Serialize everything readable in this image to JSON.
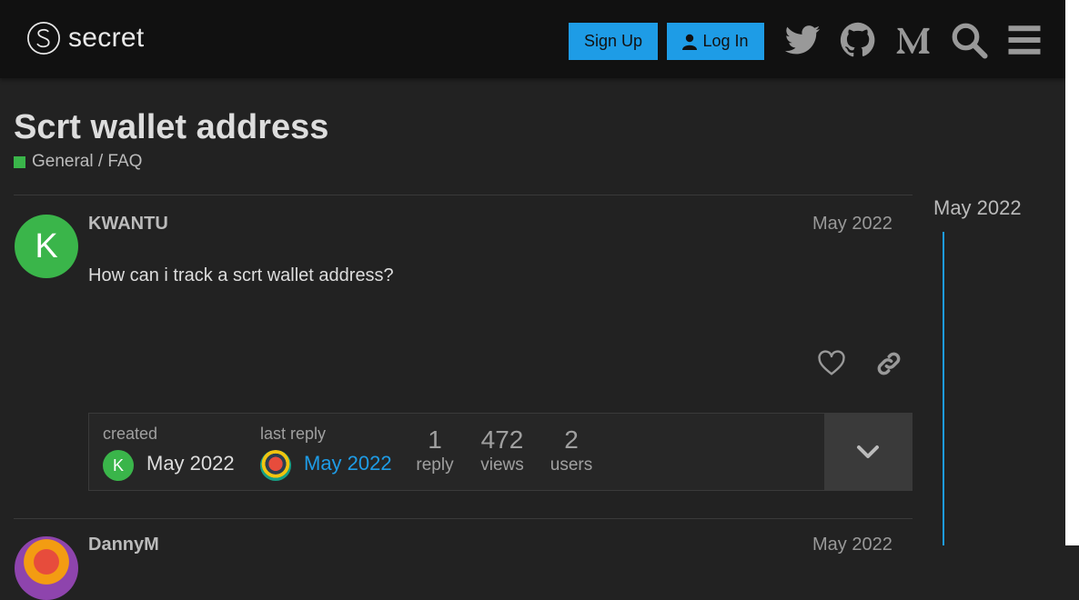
{
  "header": {
    "logo_text": "secret",
    "signup_label": "Sign Up",
    "login_label": "Log In",
    "icons": [
      "twitter-icon",
      "github-icon",
      "medium-icon",
      "search-icon",
      "menu-icon"
    ]
  },
  "topic": {
    "title": "Scrt wallet address",
    "category": "General / FAQ",
    "category_color": "#3ab54a"
  },
  "post": {
    "avatar_letter": "K",
    "username": "KWANTU",
    "date": "May 2022",
    "body": "How can i track a scrt wallet address?"
  },
  "topic_map": {
    "created_label": "created",
    "created_avatar_letter": "K",
    "created_date": "May 2022",
    "last_reply_label": "last reply",
    "last_reply_date": "May 2022",
    "replies_count": "1",
    "replies_label": "reply",
    "views_count": "472",
    "views_label": "views",
    "users_count": "2",
    "users_label": "users"
  },
  "timeline": {
    "date": "May 2022"
  },
  "post2": {
    "username": "DannyM",
    "date": "May 2022"
  },
  "colors": {
    "accent": "#1e9ce6",
    "header_bg": "#111111",
    "page_bg": "#222222"
  }
}
